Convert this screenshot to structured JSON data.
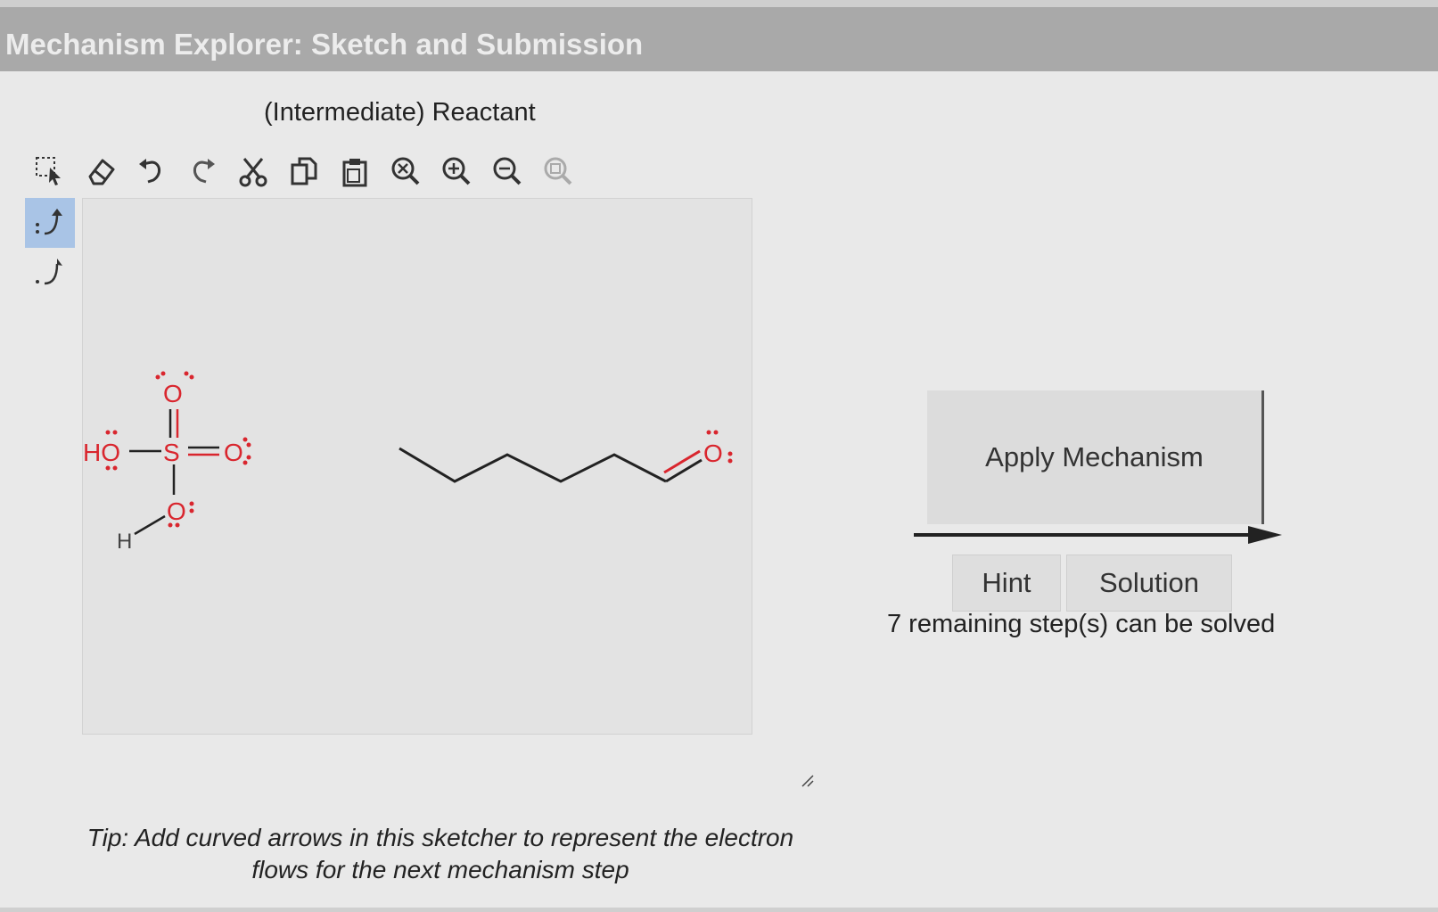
{
  "window": {
    "title": "Mechanism Explorer: Sketch and Submission"
  },
  "sketcher": {
    "panel_title": "(Intermediate) Reactant",
    "toolbar_icons": [
      "select-icon",
      "eraser-icon",
      "undo-icon",
      "redo-icon",
      "cut-icon",
      "copy-icon",
      "paste-icon",
      "zoom-reset-icon",
      "zoom-in-icon",
      "zoom-out-icon",
      "zoom-fit-icon"
    ],
    "side_tools": [
      "electron-pair-arrow-icon",
      "single-electron-arrow-icon"
    ],
    "molecule1": {
      "atoms": {
        "ho": "HO",
        "s": "S",
        "o_top": "O",
        "o_right": "O",
        "o_bottom": "O",
        "h": "H"
      }
    },
    "molecule2": {
      "atoms": {
        "o": "O"
      }
    }
  },
  "actions": {
    "apply_label": "Apply Mechanism",
    "hint_label": "Hint",
    "solution_label": "Solution",
    "remaining_text": "7 remaining step(s) can be solved"
  },
  "tip": {
    "line1": "Tip: Add curved arrows in this sketcher to represent the electron",
    "line2": "flows for the next mechanism step"
  },
  "colors": {
    "oxygen": "#d9262e",
    "active_tool": "#a9c4e6"
  }
}
